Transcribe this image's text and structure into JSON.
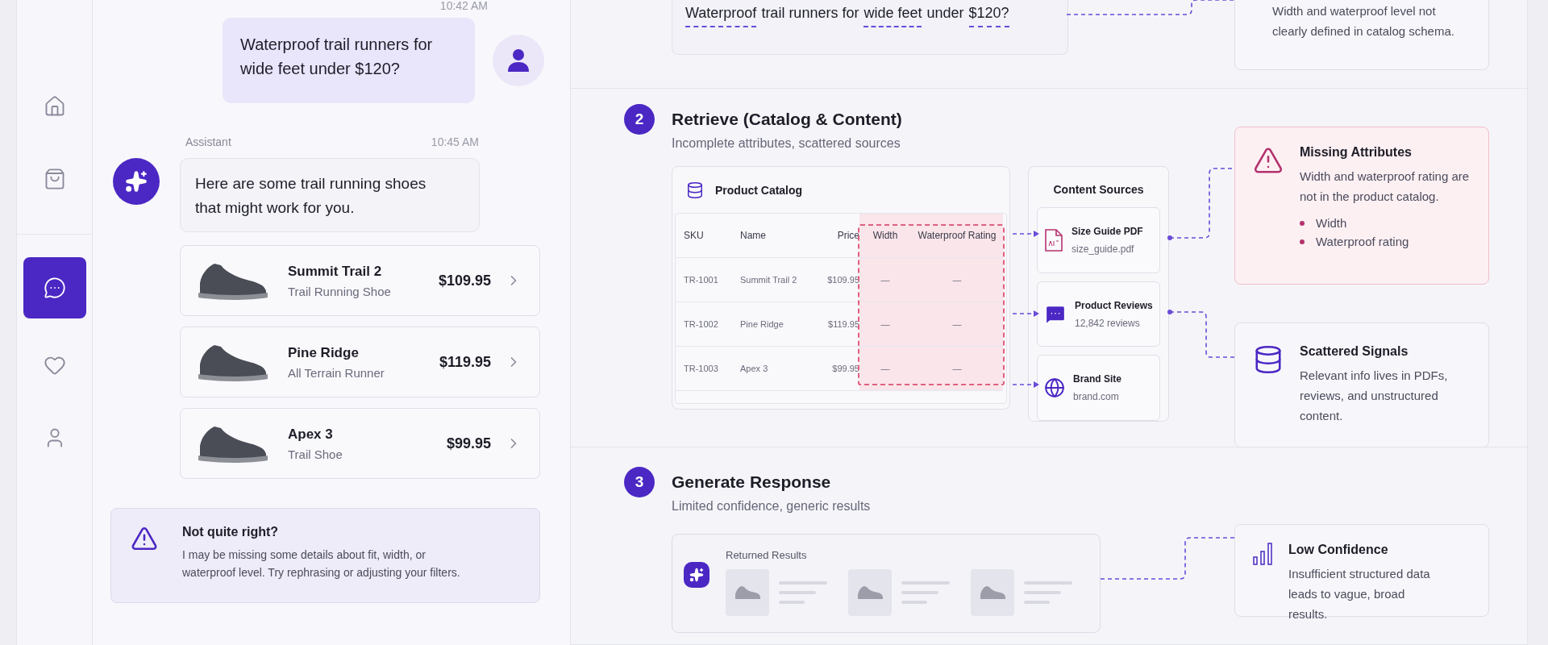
{
  "sidebar": {
    "groups": [
      {
        "items": [
          {
            "kind": "home",
            "selected": false
          },
          {
            "kind": "bag",
            "selected": false
          }
        ]
      },
      {
        "items": [
          {
            "kind": "chat",
            "selected": true
          },
          {
            "kind": "heart",
            "selected": false
          },
          {
            "kind": "user",
            "selected": false
          }
        ]
      }
    ]
  },
  "chat": {
    "messages": [
      {
        "time": "10:42 AM",
        "text": "Waterproof trail runners for wide feet under $120?"
      },
      {
        "sender": "Assistant",
        "time": "10:45 AM",
        "text": "Here are some trail running shoes that might work for you.",
        "products": [
          {
            "name": "Summit Trail 2",
            "type": "Trail Running Shoe",
            "price": "$109.95"
          },
          {
            "name": "Pine Ridge",
            "type": "All Terrain Runner",
            "price": "$119.95"
          },
          {
            "name": "Apex 3",
            "type": "Trail Shoe",
            "price": "$99.95"
          }
        ]
      }
    ],
    "notice": {
      "title": "Not quite right?",
      "text": "I may be missing some details about fit, width, or waterproof level. Try rephrasing or adjusting your filters."
    }
  },
  "query_step": {
    "segments": [
      {
        "text": "Waterproof",
        "highlighted": true
      },
      {
        "text": "trail runners for",
        "highlighted": false
      },
      {
        "text": "wide feet",
        "highlighted": true
      },
      {
        "text": "under",
        "highlighted": false
      },
      {
        "text": "$120?",
        "highlighted": true
      }
    ],
    "issue": {
      "text": "Width and waterproof level not clearly defined in catalog schema."
    }
  },
  "retrieve_step": {
    "number": "2",
    "title": "Retrieve (Catalog & Content)",
    "subtitle": "Incomplete attributes, scattered sources",
    "catalog": {
      "title": "Product Catalog",
      "columns": [
        {
          "label": "SKU",
          "missing": false
        },
        {
          "label": "Name",
          "missing": false
        },
        {
          "label": "Price",
          "missing": false
        },
        {
          "label": "Width",
          "missing": true
        },
        {
          "label": "Waterproof Rating",
          "missing": true
        }
      ],
      "rows": [
        [
          "TR-1001",
          "Summit Trail 2",
          "$109.95",
          "—",
          "—"
        ],
        [
          "TR-1002",
          "Pine Ridge",
          "$119.95",
          "—",
          "—"
        ],
        [
          "TR-1003",
          "Apex 3",
          "$99.95",
          "—",
          "—"
        ]
      ]
    },
    "sources": {
      "title": "Content Sources",
      "items": [
        {
          "kind": "pdf",
          "title": "Size Guide PDF",
          "detail": "size_guide.pdf"
        },
        {
          "kind": "reviews",
          "title": "Product Reviews",
          "detail": "12,842 reviews"
        },
        {
          "kind": "web",
          "title": "Brand Site",
          "detail": "brand.com"
        }
      ]
    },
    "missing": {
      "kind": "warning",
      "title": "Missing Attributes",
      "text": "Width and waterproof rating are not in the product catalog.",
      "items": [
        "Width",
        "Waterproof rating"
      ]
    },
    "scattered": {
      "kind": "database",
      "title": "Scattered Signals",
      "text": "Relevant info lives in PDFs, reviews, and unstructured content."
    }
  },
  "generate_step": {
    "number": "3",
    "title": "Generate Response",
    "subtitle": "Limited confidence, generic results",
    "results": {
      "title": "Returned Results"
    },
    "confidence": {
      "kind": "bars",
      "title": "Low Confidence",
      "text": "Insufficient structured data leads to vague, broad results."
    }
  }
}
